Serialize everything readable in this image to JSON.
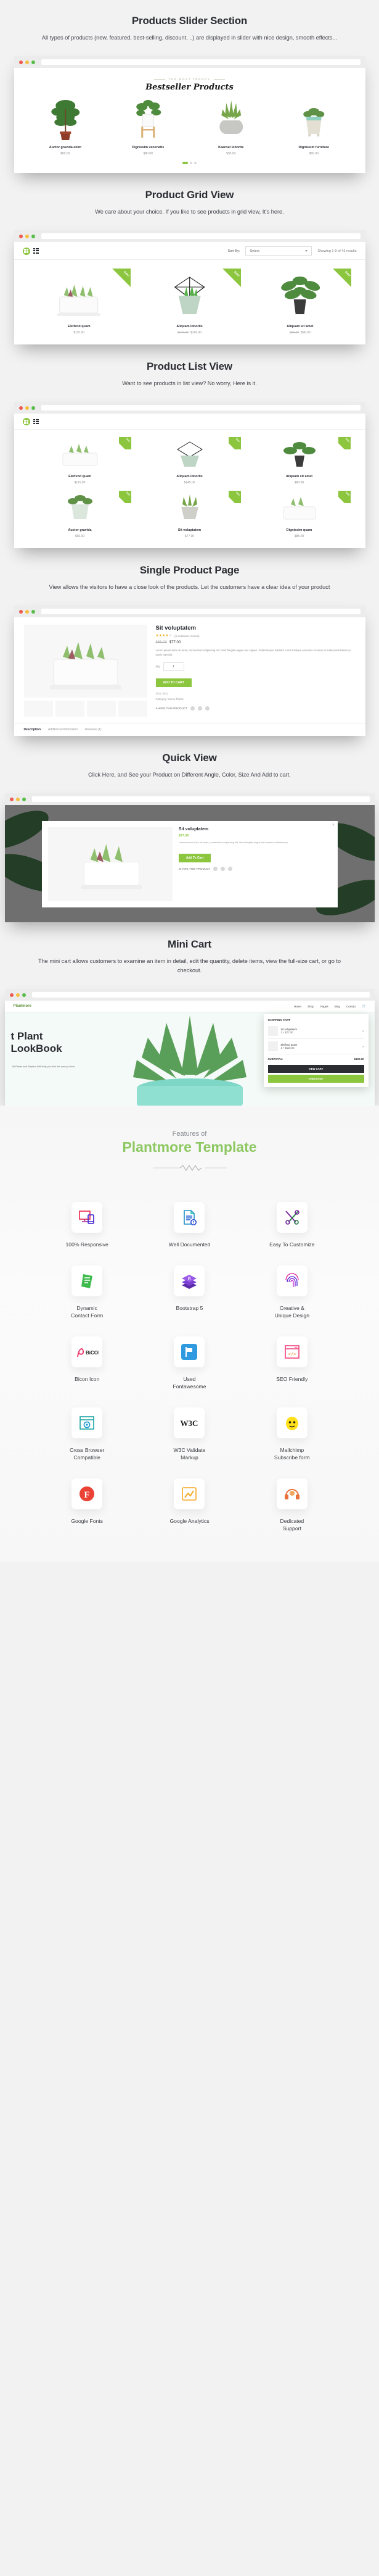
{
  "sections": [
    {
      "id": "products-slider",
      "title": "Products Slider Section",
      "subtitle": "All types of products (new, featured, best-selling, discount, ..) are displayed in slider with nice design, smooth effects..."
    },
    {
      "id": "product-grid",
      "title": "Product Grid View",
      "subtitle": "We care about your choice. If you like to see products in grid view, It's here."
    },
    {
      "id": "product-list",
      "title": "Product List View",
      "subtitle": "Want to see products in list view? No worry, Here is it."
    },
    {
      "id": "single-product",
      "title": "Single Product Page",
      "subtitle": "View allows the visitors to have a close look of the products. Let the customers have a clear idea of your product"
    },
    {
      "id": "quick-view",
      "title": "Quick View",
      "subtitle": "Click Here, and See your Product on Different Angle, Color, Size And Add to cart."
    },
    {
      "id": "mini-cart",
      "title": "Mini Cart",
      "subtitle": "The mini cart allows customers to examine an item in detail, edit the quantity, delete items, view the full-size cart, or go to checkout."
    }
  ],
  "slider": {
    "kicker": "THE MOST TRENDY",
    "heading": "Bestseller Products",
    "products": [
      {
        "name": "Auctor gravida enim",
        "price": "$60.00"
      },
      {
        "name": "Dignissim venenatis",
        "price": "$80.00"
      },
      {
        "name": "Kaaroat lobortis",
        "price": "$95.00"
      },
      {
        "name": "Dignissim furniture",
        "price": "$60.00"
      }
    ]
  },
  "grid": {
    "toolbar": {
      "grid_icon": "grid-view-icon",
      "list_icon": "list-view-icon",
      "sort_label": "Sort By:",
      "sort_value": "Select",
      "results": "Showing 1-9 of 42 results"
    },
    "badge": "Sale!",
    "products": [
      {
        "name": "Eleifend quam",
        "old": "",
        "price": "$115.00"
      },
      {
        "name": "Aliquam lobortis",
        "old": "$140.00",
        "price": "$145.00"
      },
      {
        "name": "Aliquam sit amet",
        "old": "$99.00",
        "price": "$90.00"
      }
    ]
  },
  "list": {
    "badge": "Sale!",
    "products": [
      {
        "name": "Eleifend quam",
        "price": "$115.00"
      },
      {
        "name": "Aliquam lobortis",
        "price": "$145.00"
      },
      {
        "name": "Aliquam sit amet",
        "price": "$90.00"
      },
      {
        "name": "Auctor gravida",
        "price": "$60.00"
      },
      {
        "name": "Sit voluptatem",
        "price": "$77.00"
      },
      {
        "name": "Dignissim quam",
        "price": "$85.00"
      }
    ]
  },
  "single": {
    "title": "Sit voluptatem",
    "stars": "★★★★",
    "star_off": "★",
    "review": "(1 customer review)",
    "price_old": "$66.00",
    "price_new": "$77.00",
    "description": "Lorem ipsum dolor sit amet, consectetur adipiscing elit. Nam fringilla augue nec sapien. Pellentesque habitant morbi tristique senectus et netus et malesuada fames ac turpis egestas.",
    "qty_label": "Qty",
    "qty_value": "1",
    "add_to_cart": "ADD TO CART",
    "meta_sku": "SKU: 0012",
    "meta_category": "Category: Indoor Plants",
    "share_label": "SHARE THIS PRODUCT",
    "tabs": [
      "Description",
      "Additional information",
      "Reviews (1)"
    ]
  },
  "quickview": {
    "title": "Sit voluptatem",
    "price": "$77.00",
    "description": "Lorem ipsum dolor sit amet, consectetur adipiscing elit. Nam fringilla augue nec sapien pellentesque.",
    "add_to_cart": "Add To Cart",
    "share_label": "SHARE THIS PRODUCT",
    "close_icon": "close-icon"
  },
  "minicart": {
    "logo": "Plantmore",
    "nav": [
      "Home",
      "Shop",
      "Pages",
      "Blog",
      "Contact"
    ],
    "hero_line1": "t Plant",
    "hero_line2": "LookBook",
    "hero_sub": "All Plants and Replant Will Help you find the one you love",
    "panel_title": "SHOPPING CART",
    "items": [
      {
        "name": "Sit voluptatem",
        "qty": "1 × $77.00"
      },
      {
        "name": "Eleifend quam",
        "qty": "1 × $115.00"
      }
    ],
    "subtotal_label": "SUBTOTAL:",
    "subtotal_value": "$192.00",
    "view_cart": "VIEW CART",
    "checkout": "CHECKOUT"
  },
  "features": {
    "kicker": "Features of",
    "title": "Plantmore Template",
    "accent": "#8dc863",
    "items": [
      {
        "label": "100% Responsive",
        "icon": "responsive-devices-icon"
      },
      {
        "label": "Well Documented",
        "icon": "document-icon"
      },
      {
        "label": "Easy To Customize",
        "icon": "tools-icon"
      },
      {
        "label": "Dynamic\nContact Form",
        "icon": "contact-form-icon"
      },
      {
        "label": "Bootstrap 5",
        "icon": "bootstrap-icon"
      },
      {
        "label": "Creative &\nUnique Design",
        "icon": "fingerprint-icon"
      },
      {
        "label": "Bicon Icon",
        "icon": "bicon-logo-icon"
      },
      {
        "label": "Used\nFontawesome",
        "icon": "fontawesome-flag-icon"
      },
      {
        "label": "SEO Friendly",
        "icon": "seo-code-icon"
      },
      {
        "label": "Cross Browser\nCompatible",
        "icon": "cross-browser-icon"
      },
      {
        "label": "W3C Validate\nMarkup",
        "icon": "w3c-icon"
      },
      {
        "label": "Mailchimp\nSubscribe form",
        "icon": "mailchimp-icon"
      },
      {
        "label": "Google Fonts",
        "icon": "google-fonts-icon"
      },
      {
        "label": "Google Analytics",
        "icon": "google-analytics-icon"
      },
      {
        "label": "Dedicated\nSupport",
        "icon": "support-headset-icon"
      }
    ]
  }
}
